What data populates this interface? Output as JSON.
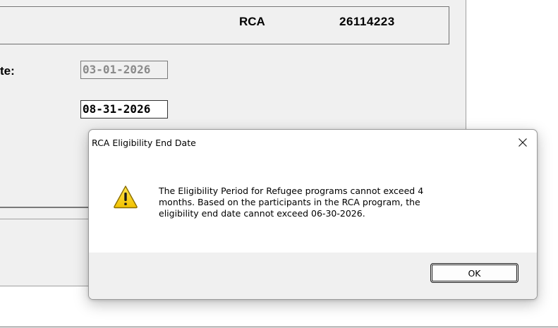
{
  "background_form": {
    "program": "RCA",
    "case_number": "26114223",
    "start_date_label_fragment": "te:",
    "start_date_value": "03-01-2026",
    "end_date_value": "08-31-2026"
  },
  "dialog": {
    "title": "RCA Eligibility End Date",
    "close_glyph": "✕",
    "icon": "warning-icon",
    "message_lines": [
      "The Eligibility Period for Refugee programs cannot exceed 4",
      "months. Based on the participants in the RCA program, the",
      "eligibility end date cannot exceed 06-30-2026."
    ],
    "ok_label": "OK"
  },
  "colors": {
    "window_background": "#f0f0f0",
    "warning_yellow": "#f7d51d",
    "button_border": "#1b1b1b"
  }
}
